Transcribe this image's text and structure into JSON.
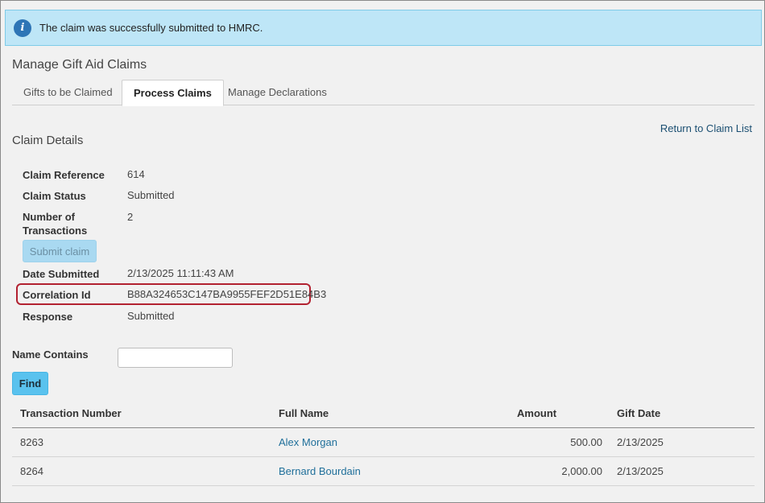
{
  "alert": {
    "icon": "info-icon",
    "message": "The claim was successfully submitted to HMRC."
  },
  "page": {
    "title": "Manage Gift Aid Claims"
  },
  "tabs": [
    {
      "label": "Gifts to be Claimed",
      "active": false
    },
    {
      "label": "Process Claims",
      "active": true
    },
    {
      "label": "Manage Declarations",
      "active": false
    }
  ],
  "claim": {
    "section_title": "Claim Details",
    "return_link": "Return to Claim List",
    "reference_label": "Claim Reference",
    "reference_value": "614",
    "status_label": "Claim Status",
    "status_value": "Submitted",
    "transactions_label": "Number of Transactions",
    "transactions_value": "2",
    "submit_button": "Submit claim",
    "date_label": "Date Submitted",
    "date_value": "2/13/2025 11:11:43 AM",
    "correlation_label": "Correlation Id",
    "correlation_value": "B88A324653C147BA9955FEF2D51E84B3",
    "response_label": "Response",
    "response_value": "Submitted"
  },
  "filter": {
    "name_label": "Name Contains",
    "name_value": "",
    "find_button": "Find"
  },
  "table": {
    "headers": {
      "number": "Transaction Number",
      "name": "Full Name",
      "amount": "Amount",
      "date": "Gift Date"
    },
    "rows": [
      {
        "number": "8263",
        "name": "Alex Morgan",
        "amount": "500.00",
        "date": "2/13/2025"
      },
      {
        "number": "8264",
        "name": "Bernard Bourdain",
        "amount": "2,000.00",
        "date": "2/13/2025"
      }
    ]
  },
  "colors": {
    "alert_bg": "#bee6f7",
    "highlight": "#b22130",
    "find_button": "#5ac2ee",
    "link": "#1f6f9a"
  }
}
